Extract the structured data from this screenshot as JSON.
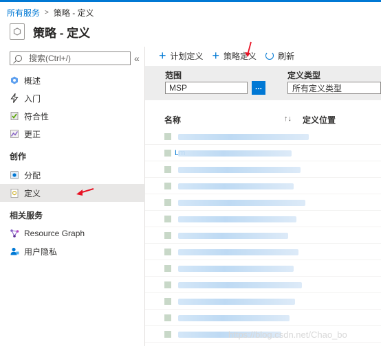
{
  "breadcrumb": {
    "root": "所有服务",
    "current": "策略 - 定义"
  },
  "page": {
    "title": "策略 - 定义"
  },
  "sidebar": {
    "search_placeholder": "搜索(Ctrl+/)",
    "collapse": "«",
    "items": [
      {
        "label": "概述",
        "icon": "overview-icon"
      },
      {
        "label": "入门",
        "icon": "lightning-icon"
      },
      {
        "label": "符合性",
        "icon": "compliance-icon"
      },
      {
        "label": "更正",
        "icon": "remediation-icon"
      }
    ],
    "section_authoring": "创作",
    "authoring_items": [
      {
        "label": "分配",
        "icon": "assignment-icon"
      },
      {
        "label": "定义",
        "icon": "definition-icon",
        "active": true
      }
    ],
    "section_related": "相关服务",
    "related_items": [
      {
        "label": "Resource Graph",
        "icon": "resource-graph-icon"
      },
      {
        "label": "用户隐私",
        "icon": "user-privacy-icon"
      }
    ]
  },
  "toolbar": {
    "initiative_definition": "计划定义",
    "policy_definition": "策略定义",
    "refresh": "刷新"
  },
  "filters": {
    "scope_label": "范围",
    "scope_value": "MSP",
    "scope_button": "...",
    "type_label": "定义类型",
    "type_value": "所有定义类型"
  },
  "table": {
    "col_name": "名称",
    "sort": "↑↓",
    "col_location": "定义位置",
    "row2_prefix": "Lm",
    "row_count": 13
  },
  "watermark": "https://blog.csdn.net/Chao_bo",
  "colors": {
    "accent": "#0078d4",
    "annotation_arrow": "#e81123"
  }
}
